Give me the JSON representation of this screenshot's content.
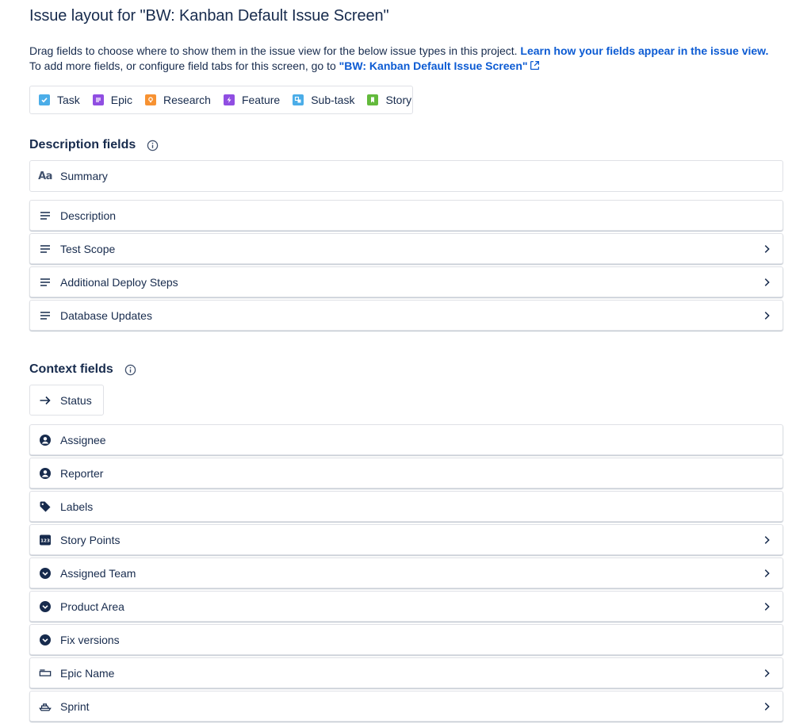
{
  "header": {
    "title": "Issue layout for \"BW: Kanban Default Issue Screen\""
  },
  "intro": {
    "line1_text": "Drag fields to choose where to show them in the issue view for the below issue types in this project. ",
    "line1_link": "Learn how your fields appear in the issue view.",
    "line2_text": "To add more fields, or configure field tabs for this screen, go to ",
    "line2_link": "\"BW: Kanban Default Issue Screen\""
  },
  "issue_types": [
    {
      "label": "Task",
      "icon": "task-icon",
      "color": "#4bade8"
    },
    {
      "label": "Epic",
      "icon": "epic-icon",
      "color": "#904ee2"
    },
    {
      "label": "Research",
      "icon": "research-icon",
      "color": "#f79232"
    },
    {
      "label": "Feature",
      "icon": "feature-icon",
      "color": "#904ee2"
    },
    {
      "label": "Sub-task",
      "icon": "subtask-icon",
      "color": "#4bade8"
    },
    {
      "label": "Story",
      "icon": "story-icon",
      "color": "#63ba3c"
    }
  ],
  "description_section": {
    "title": "Description fields",
    "fields": [
      {
        "label": "Summary",
        "icon": "text-aa-icon",
        "chevron": false
      },
      {
        "label": "Description",
        "icon": "paragraph-icon",
        "chevron": false
      },
      {
        "label": "Test Scope",
        "icon": "paragraph-icon",
        "chevron": true
      },
      {
        "label": "Additional Deploy Steps",
        "icon": "paragraph-icon",
        "chevron": true
      },
      {
        "label": "Database Updates",
        "icon": "paragraph-icon",
        "chevron": true
      }
    ]
  },
  "context_section": {
    "title": "Context fields",
    "fields": [
      {
        "label": "Status",
        "icon": "arrow-right-icon",
        "chevron": false
      },
      {
        "label": "Assignee",
        "icon": "person-icon",
        "chevron": false
      },
      {
        "label": "Reporter",
        "icon": "person-icon",
        "chevron": false
      },
      {
        "label": "Labels",
        "icon": "tag-icon",
        "chevron": false
      },
      {
        "label": "Story Points",
        "icon": "number-icon",
        "chevron": true
      },
      {
        "label": "Assigned Team",
        "icon": "dropdown-icon",
        "chevron": true
      },
      {
        "label": "Product Area",
        "icon": "dropdown-icon",
        "chevron": true
      },
      {
        "label": "Fix versions",
        "icon": "dropdown-icon",
        "chevron": false
      },
      {
        "label": "Epic Name",
        "icon": "short-text-icon",
        "chevron": true
      },
      {
        "label": "Sprint",
        "icon": "sprint-icon",
        "chevron": true
      }
    ]
  },
  "colors": {
    "text": "#172b4d",
    "link": "#0c5bd3",
    "border": "#dfe1e6",
    "icon": "#42526e"
  },
  "number_icon_text": "123"
}
